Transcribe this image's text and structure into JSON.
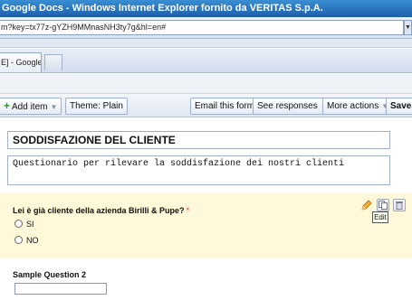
{
  "window": {
    "title": "Google Docs - Windows Internet Explorer fornito da VERITAS S.p.A."
  },
  "address": {
    "url": "m?key=tx77z-gYZH9MMnasNH3ty7g&hl=en#"
  },
  "tabs": [
    {
      "label": "E] - Google ..."
    }
  ],
  "toolbar": {
    "add_item": "Add item",
    "theme": "Theme: Plain",
    "email": "Email this form",
    "responses": "See responses",
    "more_actions": "More actions",
    "save": "Save"
  },
  "form": {
    "title": "SODDISFAZIONE DEL CLIENTE",
    "description": "Questionario per rilevare la soddisfazione dei nostri clienti",
    "questions": [
      {
        "title": "Lei è già cliente della azienda Birilli & Pupe?",
        "required_mark": "*",
        "options": [
          "SI",
          "NO"
        ],
        "actions": {
          "edit_tooltip": "Edit"
        }
      },
      {
        "title": "Sample Question 2"
      }
    ]
  },
  "icons": {
    "add": "plus-icon",
    "dropdown": "chevron-down-icon",
    "edit": "pencil-icon",
    "duplicate": "duplicate-icon",
    "delete": "trash-icon"
  }
}
